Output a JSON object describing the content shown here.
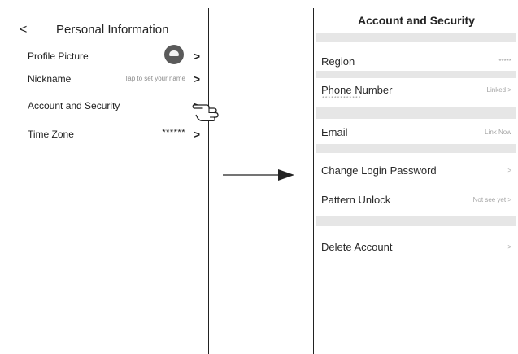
{
  "personal_info": {
    "back_label": "<",
    "title": "Personal Information",
    "rows": [
      {
        "label": "Profile Picture",
        "value": "",
        "chevron": ">"
      },
      {
        "label": "Nickname",
        "value": "Tap to set your name",
        "chevron": ">"
      },
      {
        "label": "Account and Security",
        "value": "",
        "chevron": ">"
      },
      {
        "label": "Time Zone",
        "value": "******",
        "chevron": ">"
      }
    ]
  },
  "account_security": {
    "title": "Account and Security",
    "rows": [
      {
        "label": "Region",
        "value": "*****"
      },
      {
        "label": "Phone Number",
        "sub": "*************",
        "value": "Linked >"
      },
      {
        "label": "Email",
        "value": "Link Now"
      },
      {
        "label": "Change Login Password",
        "value": ">"
      },
      {
        "label": "Pattern Unlock",
        "value": "Not see yet >"
      },
      {
        "label": "Delete Account",
        "value": ">"
      }
    ]
  },
  "colors": {
    "separator_band": "#e6e6e6",
    "secondary_text": "#a5a5a5",
    "primary_text": "#2a2a2a"
  },
  "icons": [
    "back-chevron-icon",
    "avatar-icon",
    "pointing-hand-icon",
    "right-arrow-icon"
  ]
}
